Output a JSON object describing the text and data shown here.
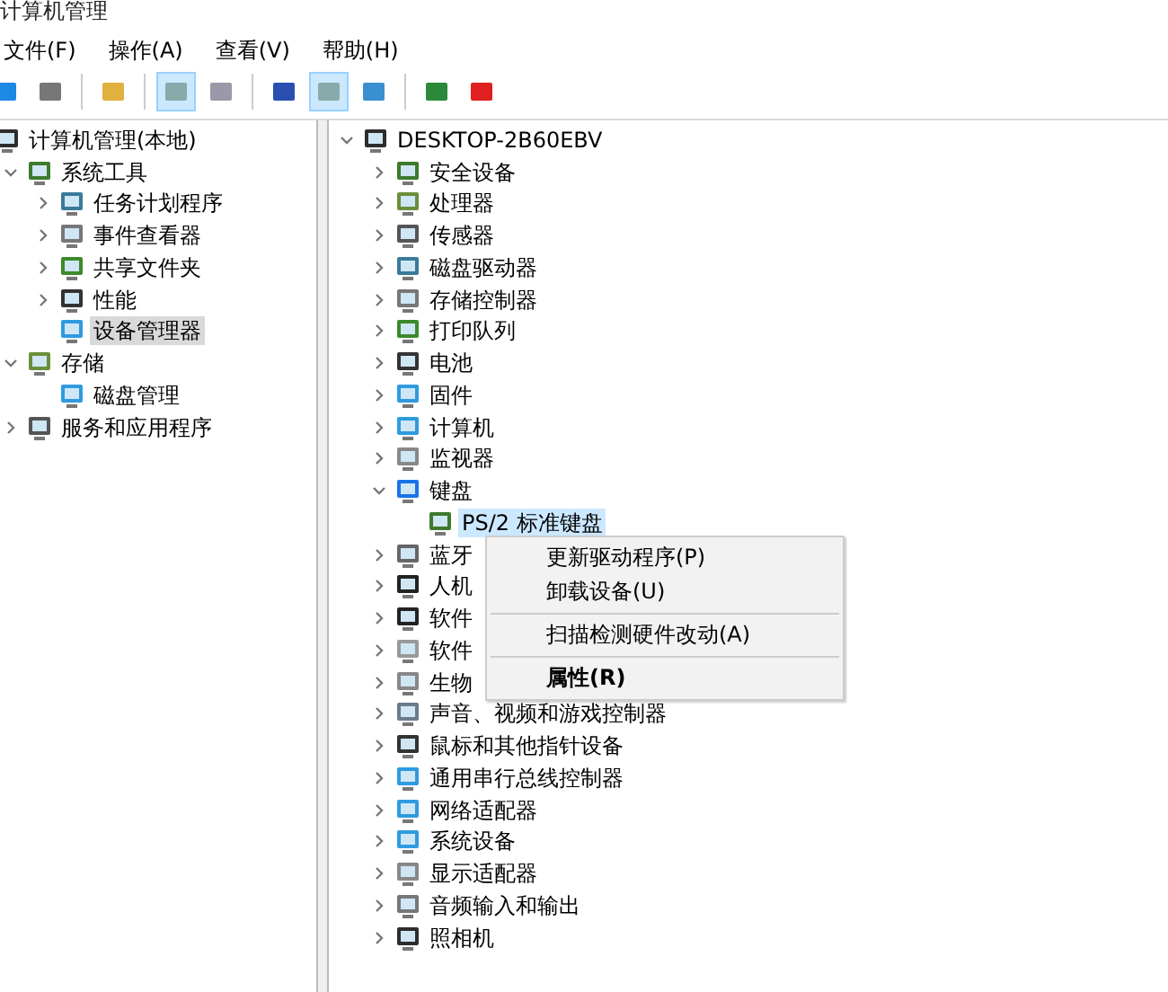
{
  "window": {
    "title": "计算机管理"
  },
  "menu_bar": [
    "文件(F)",
    "操作(A)",
    "查看(V)",
    "帮助(H)"
  ],
  "toolbar": [
    {
      "pressed": false
    },
    {
      "pressed": false
    },
    {
      "pressed": false
    },
    {
      "pressed": true
    },
    {
      "pressed": false
    },
    {
      "pressed": false
    },
    {
      "pressed": true
    },
    {
      "pressed": false
    },
    {
      "pressed": false
    },
    {
      "pressed": false
    }
  ],
  "sidebar": {
    "items": [
      {
        "label": "计算机管理(本地)",
        "selected": false,
        "children": [
          {
            "label": "系统工具",
            "expandable": true,
            "expanded": true,
            "selected": false,
            "children": [
              {
                "label": "任务计划程序",
                "expandable": true,
                "expanded": false,
                "selected": false
              },
              {
                "label": "事件查看器",
                "expandable": true,
                "expanded": false,
                "selected": false
              },
              {
                "label": "共享文件夹",
                "expandable": true,
                "expanded": false,
                "selected": false
              },
              {
                "label": "性能",
                "expandable": true,
                "expanded": false,
                "selected": false
              },
              {
                "label": "设备管理器",
                "expandable": false,
                "expanded": false,
                "selected": true
              }
            ]
          },
          {
            "label": "存储",
            "expandable": true,
            "expanded": true,
            "selected": false,
            "children": [
              {
                "label": "磁盘管理",
                "expandable": false,
                "expanded": false,
                "selected": false
              }
            ]
          },
          {
            "label": "服务和应用程序",
            "expandable": true,
            "expanded": false,
            "selected": false
          }
        ]
      }
    ]
  },
  "device_tree": {
    "items": [
      {
        "label": "DESKTOP-2B60EBV",
        "expandable": true,
        "expanded": true,
        "selected": false,
        "children": [
          {
            "label": "安全设备",
            "expandable": true,
            "expanded": false,
            "selected": false
          },
          {
            "label": "处理器",
            "expandable": true,
            "expanded": false,
            "selected": false
          },
          {
            "label": "传感器",
            "expandable": true,
            "expanded": false,
            "selected": false
          },
          {
            "label": "磁盘驱动器",
            "expandable": true,
            "expanded": false,
            "selected": false
          },
          {
            "label": "存储控制器",
            "expandable": true,
            "expanded": false,
            "selected": false
          },
          {
            "label": "打印队列",
            "expandable": true,
            "expanded": false,
            "selected": false
          },
          {
            "label": "电池",
            "expandable": true,
            "expanded": false,
            "selected": false
          },
          {
            "label": "固件",
            "expandable": true,
            "expanded": false,
            "selected": false
          },
          {
            "label": "计算机",
            "expandable": true,
            "expanded": false,
            "selected": false
          },
          {
            "label": "监视器",
            "expandable": true,
            "expanded": false,
            "selected": false
          },
          {
            "label": "键盘",
            "expandable": true,
            "expanded": true,
            "selected": false,
            "children": [
              {
                "label": "PS/2 标准键盘",
                "expandable": false,
                "expanded": false,
                "selected": true
              }
            ]
          },
          {
            "label": "蓝牙",
            "expandable": true,
            "expanded": false,
            "selected": false
          },
          {
            "label": "人机",
            "expandable": true,
            "expanded": false,
            "selected": false
          },
          {
            "label": "软件",
            "expandable": true,
            "expanded": false,
            "selected": false
          },
          {
            "label": "软件",
            "expandable": true,
            "expanded": false,
            "selected": false
          },
          {
            "label": "生物",
            "expandable": true,
            "expanded": false,
            "selected": false
          },
          {
            "label": "声音、视频和游戏控制器",
            "expandable": true,
            "expanded": false,
            "selected": false
          },
          {
            "label": "鼠标和其他指针设备",
            "expandable": true,
            "expanded": false,
            "selected": false
          },
          {
            "label": "通用串行总线控制器",
            "expandable": true,
            "expanded": false,
            "selected": false
          },
          {
            "label": "网络适配器",
            "expandable": true,
            "expanded": false,
            "selected": false
          },
          {
            "label": "系统设备",
            "expandable": true,
            "expanded": false,
            "selected": false
          },
          {
            "label": "显示适配器",
            "expandable": true,
            "expanded": false,
            "selected": false
          },
          {
            "label": "音频输入和输出",
            "expandable": true,
            "expanded": false,
            "selected": false
          },
          {
            "label": "照相机",
            "expandable": true,
            "expanded": false,
            "selected": false
          }
        ]
      }
    ]
  },
  "context_menu": {
    "items": [
      {
        "kind": "item",
        "label": "更新驱动程序(P)",
        "default": false
      },
      {
        "kind": "item",
        "label": "卸载设备(U)",
        "default": false
      },
      {
        "kind": "separator"
      },
      {
        "kind": "item",
        "label": "扫描检测硬件改动(A)",
        "default": false
      },
      {
        "kind": "separator"
      },
      {
        "kind": "item",
        "label": "属性(R)",
        "default": true
      }
    ]
  }
}
